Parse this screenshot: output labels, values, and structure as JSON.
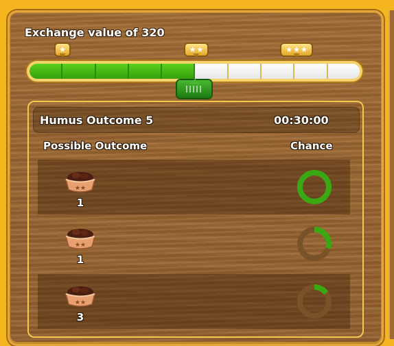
{
  "header": {
    "title": "Exchange value of 320"
  },
  "progress": {
    "segments": 10,
    "filled_segments": 5,
    "milestones": [
      {
        "stars": 1,
        "icon": "star-icon"
      },
      {
        "stars": 2,
        "icon": "star-icon"
      },
      {
        "stars": 3,
        "icon": "star-icon"
      }
    ]
  },
  "outcome": {
    "name": "Humus Outcome 5",
    "timer": "00:30:00"
  },
  "columns": {
    "outcome": "Possible Outcome",
    "chance": "Chance"
  },
  "items": [
    {
      "icon": "humus-basket-icon",
      "quantity": "1",
      "chance": 1.0
    },
    {
      "icon": "humus-basket-icon",
      "quantity": "1",
      "chance": 0.3
    },
    {
      "icon": "humus-basket-icon",
      "quantity": "3",
      "chance": 0.15
    }
  ],
  "colors": {
    "fill": "#3aa812",
    "gold": "#f4c94e",
    "wood": "#9a6430",
    "ring_track": "#7a5228"
  }
}
